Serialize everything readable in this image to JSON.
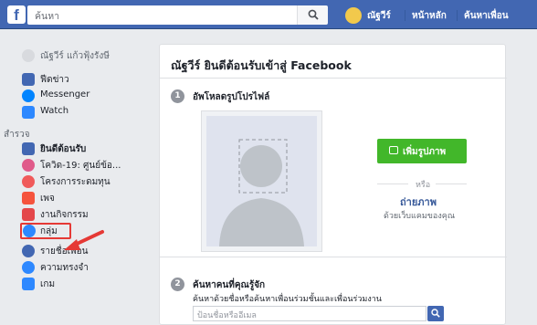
{
  "topbar": {
    "search_placeholder": "ค้นหา",
    "user_name": "ณัฐวีร์",
    "home_label": "หน้าหลัก",
    "find_friends_label": "ค้นหาเพื่อน"
  },
  "sidebar": {
    "profile_name": "ณัฐวีร์ แก้วฟุ้งรังษี",
    "items_top": [
      {
        "label": "ฟีดข่าว",
        "icon": "news-feed-icon",
        "color": "#4267b2"
      },
      {
        "label": "Messenger",
        "icon": "messenger-icon",
        "color": "#0084ff"
      },
      {
        "label": "Watch",
        "icon": "watch-icon",
        "color": "#2d88ff"
      }
    ],
    "explore_title": "สำรวจ",
    "items_explore": [
      {
        "label": "ยินดีต้อนรับ",
        "icon": "facebook-icon",
        "color": "#4267b2",
        "bold": true
      },
      {
        "label": "โควิด-19: ศูนย์ข้อ...",
        "icon": "covid-icon",
        "color": "#e05a8a"
      },
      {
        "label": "โครงการระดมทุน",
        "icon": "fundraiser-icon",
        "color": "#f05a5a"
      },
      {
        "label": "เพจ",
        "icon": "pages-icon",
        "color": "#f5533d"
      },
      {
        "label": "งานกิจกรรม",
        "icon": "events-icon",
        "color": "#e4474a"
      },
      {
        "label": "กลุ่ม",
        "icon": "groups-icon",
        "color": "#2d88ff"
      },
      {
        "label": "รายชื่อเพื่อน",
        "icon": "friends-list-icon",
        "color": "#4267b2"
      },
      {
        "label": "ความทรงจำ",
        "icon": "memories-icon",
        "color": "#2d88ff"
      },
      {
        "label": "เกม",
        "icon": "games-icon",
        "color": "#2d88ff"
      }
    ],
    "highlight_color": "#e53935"
  },
  "panel": {
    "title": "ณัฐวีร์ ยินดีต้อนรับเข้าสู่ Facebook",
    "step1": {
      "number": "1",
      "title": "อัพโหลดรูปโปรไฟล์"
    },
    "add_photo_label": "เพิ่มรูปภาพ",
    "or_label": "หรือ",
    "take_photo_label": "ถ่ายภาพ",
    "take_photo_sub": "ด้วยเว็บแคมของคุณ",
    "step2": {
      "number": "2",
      "title": "ค้นหาคนที่คุณรู้จัก"
    },
    "find_desc": "ค้นหาด้วยชื่อหรือค้นหาเพื่อนร่วมชั้นและเพื่อนร่วมงาน",
    "email_placeholder": "ป้อนชื่อหรืออีเมล"
  }
}
